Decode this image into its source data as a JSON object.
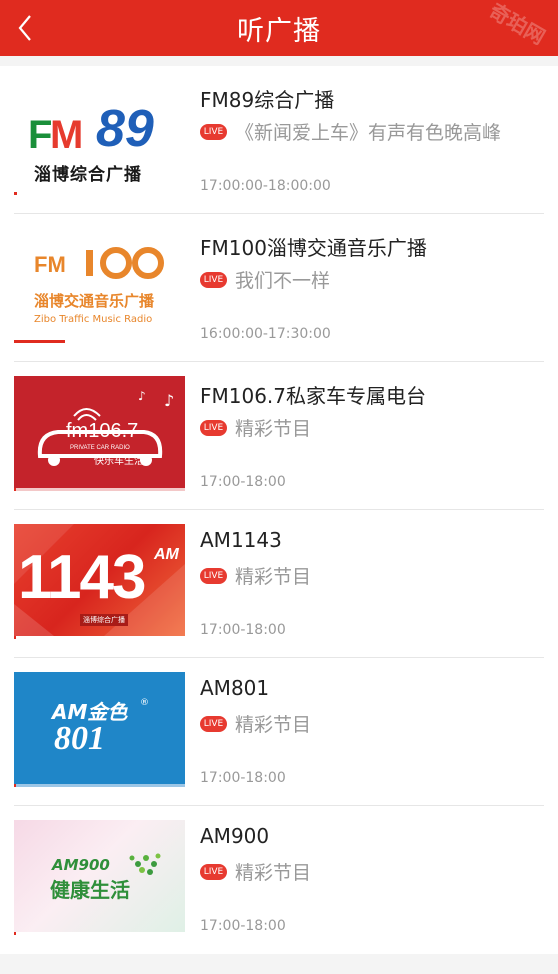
{
  "header": {
    "title": "听广播",
    "watermark": "奇珀网"
  },
  "colors": {
    "accent": "#e02b1f"
  },
  "stations": [
    {
      "name": "FM89综合广播",
      "live_label": "LIVE",
      "program": "《新闻爱上车》有声有色晚高峰",
      "time": "17:00:00-18:00:00",
      "progress": 0.02,
      "logo_line1": "FM89",
      "logo_line2": "淄博综合广播"
    },
    {
      "name": "FM100淄博交通音乐广播",
      "live_label": "LIVE",
      "program": "我们不一样",
      "time": "16:00:00-17:30:00",
      "progress": 0.3,
      "logo_line1": "FM100",
      "logo_line2": "淄博交通音乐广播",
      "logo_line3": "Zibo Traffic Music Radio"
    },
    {
      "name": "FM106.7私家车专属电台",
      "live_label": "LIVE",
      "program": "精彩节目",
      "time": "17:00-18:00",
      "progress": 0.01,
      "logo_line1": "fm106.7",
      "logo_line2": "PRIVATE CAR RADIO",
      "logo_line3": "快乐车生活"
    },
    {
      "name": "AM1143",
      "live_label": "LIVE",
      "program": "精彩节目",
      "time": "17:00-18:00",
      "progress": 0.01,
      "logo_line1": "1143",
      "logo_line2": "AM",
      "logo_line3": "淄博综合广播"
    },
    {
      "name": "AM801",
      "live_label": "LIVE",
      "program": "精彩节目",
      "time": "17:00-18:00",
      "progress": 0.01,
      "logo_line1": "AM金色",
      "logo_line2": "801"
    },
    {
      "name": "AM900",
      "live_label": "LIVE",
      "program": "精彩节目",
      "time": "17:00-18:00",
      "progress": 0.01,
      "logo_line1": "AM900",
      "logo_line2": "健康生活"
    }
  ]
}
